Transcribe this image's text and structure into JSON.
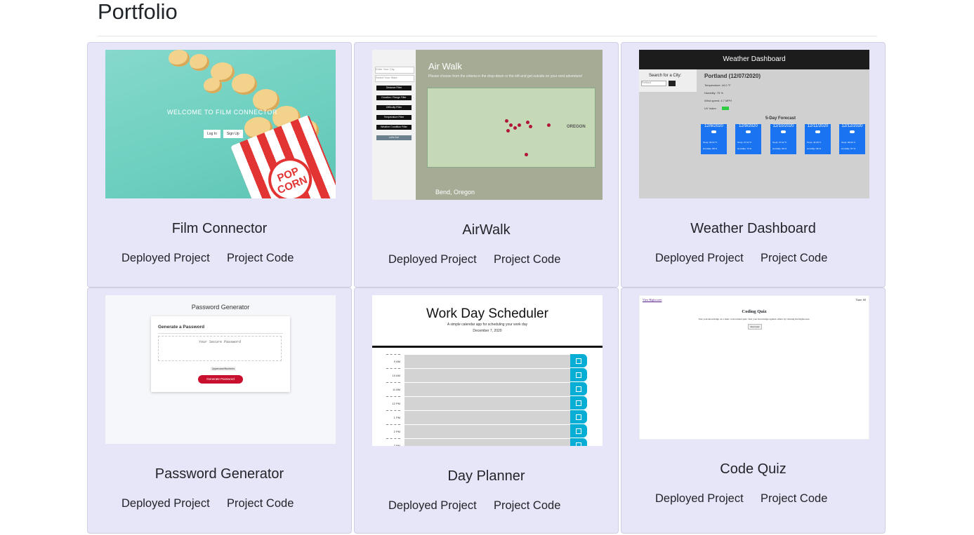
{
  "page": {
    "title": "Portfolio"
  },
  "cards": [
    {
      "title": "Film Connector",
      "deployed_label": "Deployed Project",
      "code_label": "Project Code",
      "thumb": {
        "headline": "WELCOME TO FILM CONNECTOR",
        "btn1": "Log In",
        "btn2": "Sign Up",
        "logo": "POP CORN"
      }
    },
    {
      "title": "AirWalk",
      "deployed_label": "Deployed Project",
      "code_label": "Project Code",
      "thumb": {
        "logo": "Air Walk",
        "subtitle": "Please choose from the criteria in the drop-down or the left and get outside on your next adventure!",
        "city_placeholder": "Enter Your City",
        "state_placeholder": "Select Your State",
        "filters": [
          "Distance Filter",
          "Duration / Range Filter",
          "Difficulty Filter",
          "Temperature Filter",
          "Weather Condition Filter"
        ],
        "go": "Let's Go!",
        "map_label": "OREGON",
        "location": "Bend, Oregon"
      }
    },
    {
      "title": "Weather Dashboard",
      "deployed_label": "Deployed Project",
      "code_label": "Project Code",
      "thumb": {
        "header": "Weather Dashboard",
        "search_label": "Search for a City:",
        "search_value": "Portland",
        "city": "Portland (12/07/2020)",
        "temperature": "Temperature: 44.0 °F",
        "humidity": "Humidity: 75 %",
        "wind": "Wind speed: 4.7 MPH",
        "uv": "UV Index:",
        "forecast_title": "5-Day Forecast",
        "days": [
          {
            "date": "12/8/2020",
            "temp": "Temp: 39.52 °F",
            "hum": "Humidity: 88 %"
          },
          {
            "date": "12/9/2020",
            "temp": "Temp: 37.04 °F",
            "hum": "Humidity: 74 %"
          },
          {
            "date": "12/10/2020",
            "temp": "Temp: 37.62 °F",
            "hum": "Humidity: 89 %"
          },
          {
            "date": "12/11/2020",
            "temp": "Temp: 40.28 °F",
            "hum": "Humidity: 89 %"
          },
          {
            "date": "12/12/2020",
            "temp": "Temp: 38.06 °F",
            "hum": "Humidity: 87 %"
          }
        ]
      }
    },
    {
      "title": "Password Generator",
      "deployed_label": "Deployed Project",
      "code_label": "Project Code",
      "thumb": {
        "header": "Password Generator",
        "card_title": "Generate a Password",
        "placeholder": "Your Secure Password",
        "checkbox": "Uppercase/Numbers",
        "button": "Generate Password"
      }
    },
    {
      "title": "Day Planner",
      "deployed_label": "Deployed Project",
      "code_label": "Project Code",
      "thumb": {
        "header": "Work Day Scheduler",
        "subtitle": "A simple calendar app for scheduling your work day",
        "date": "December 7, 2020",
        "hours": [
          "9 AM",
          "10 AM",
          "11 AM",
          "12 PM",
          "1 PM",
          "2 PM",
          "3 PM"
        ]
      }
    },
    {
      "title": "Code Quiz",
      "deployed_label": "Deployed Project",
      "code_label": "Project Code",
      "thumb": {
        "highscores": "View Highscores",
        "time": "Time: 60",
        "header": "Coding Quiz",
        "description": "Test your knowledge on a basic code related quiz. Test your knowledge against others by viewing the highscores.",
        "start": "Start Quiz"
      }
    }
  ]
}
